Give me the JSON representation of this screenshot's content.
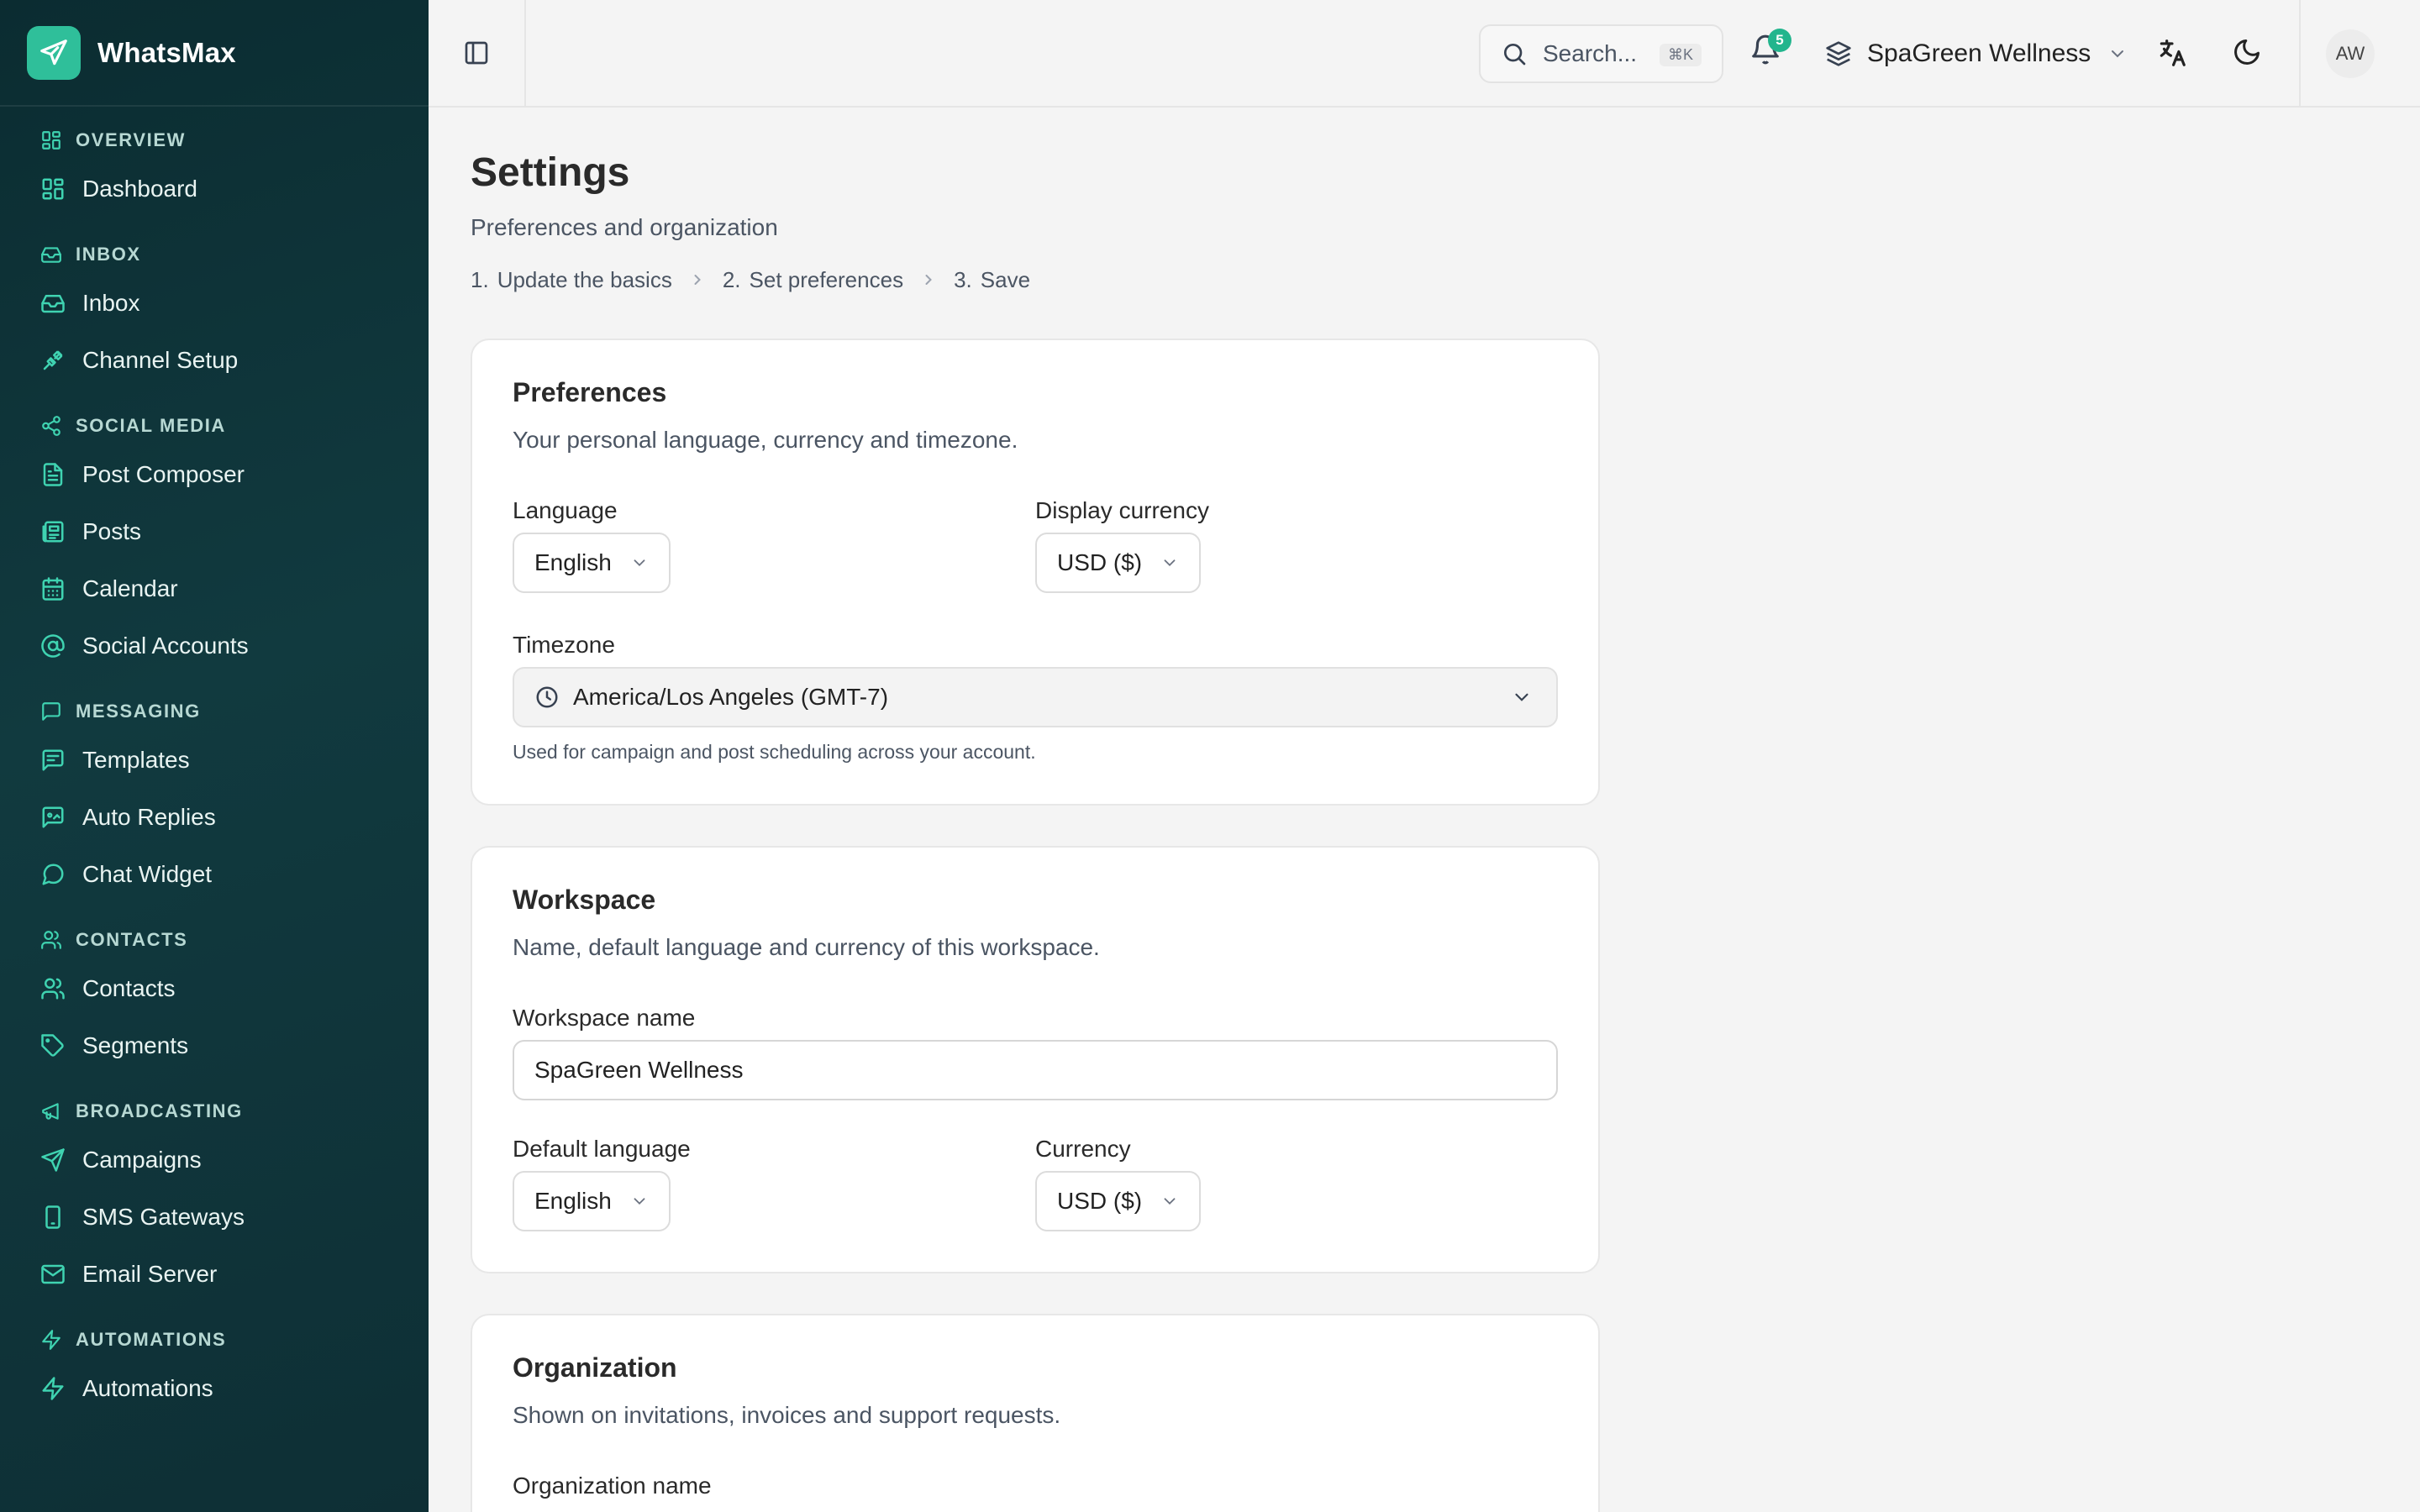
{
  "brand": {
    "name": "WhatsMax"
  },
  "colors": {
    "accent": "#3fd3b1",
    "brand_bg": "#2fbf9a",
    "badge": "#22b58d"
  },
  "sidebar": {
    "sections": [
      {
        "label": "OVERVIEW",
        "items": [
          "Dashboard"
        ]
      },
      {
        "label": "INBOX",
        "items": [
          "Inbox",
          "Channel Setup"
        ]
      },
      {
        "label": "SOCIAL MEDIA",
        "items": [
          "Post Composer",
          "Posts",
          "Calendar",
          "Social Accounts"
        ]
      },
      {
        "label": "MESSAGING",
        "items": [
          "Templates",
          "Auto Replies",
          "Chat Widget"
        ]
      },
      {
        "label": "CONTACTS",
        "items": [
          "Contacts",
          "Segments"
        ]
      },
      {
        "label": "BROADCASTING",
        "items": [
          "Campaigns",
          "SMS Gateways",
          "Email Server"
        ]
      },
      {
        "label": "AUTOMATIONS",
        "items": [
          "Automations"
        ]
      }
    ]
  },
  "topbar": {
    "search_placeholder": "Search...",
    "search_shortcut": "⌘K",
    "notification_count": "5",
    "workspace_name": "SpaGreen Wellness",
    "avatar_initials": "AW"
  },
  "page": {
    "title": "Settings",
    "subtitle": "Preferences and organization",
    "steps": [
      {
        "num": "1.",
        "label": "Update the basics"
      },
      {
        "num": "2.",
        "label": "Set preferences"
      },
      {
        "num": "3.",
        "label": "Save"
      }
    ]
  },
  "preferences": {
    "title": "Preferences",
    "description": "Your personal language, currency and timezone.",
    "language_label": "Language",
    "language_value": "English",
    "currency_label": "Display currency",
    "currency_value": "USD ($)",
    "timezone_label": "Timezone",
    "timezone_value": "America/Los Angeles (GMT-7)",
    "timezone_hint": "Used for campaign and post scheduling across your account."
  },
  "workspace": {
    "title": "Workspace",
    "description": "Name, default language and currency of this workspace.",
    "name_label": "Workspace name",
    "name_value": "SpaGreen Wellness",
    "language_label": "Default language",
    "language_value": "English",
    "currency_label": "Currency",
    "currency_value": "USD ($)"
  },
  "organization": {
    "title": "Organization",
    "description": "Shown on invitations, invoices and support requests.",
    "name_label": "Organization name"
  }
}
